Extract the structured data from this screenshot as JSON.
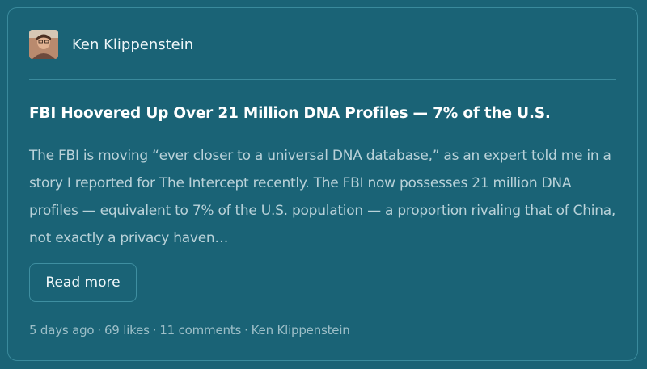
{
  "post": {
    "author": "Ken Klippenstein",
    "title": "FBI Hoovered Up Over 21 Million DNA Profiles — 7% of the U.S.",
    "excerpt": "The FBI is moving “ever closer to a universal DNA database,” as an expert told me in a story I reported for The Intercept recently. The FBI now possesses 21 million DNA profiles — equivalent to 7% of the U.S. population — a proportion rivaling that of China, not exactly a privacy haven…",
    "read_more_label": "Read more",
    "meta": {
      "age": "5 days ago",
      "likes": "69 likes",
      "comments": "11 comments",
      "author": "Ken Klippenstein",
      "separator": "·"
    }
  },
  "colors": {
    "background": "#1a6376",
    "border": "#3a8a9c",
    "title": "#ffffff",
    "body_text": "#b9d2d9",
    "meta_text": "#9dbfc8"
  }
}
